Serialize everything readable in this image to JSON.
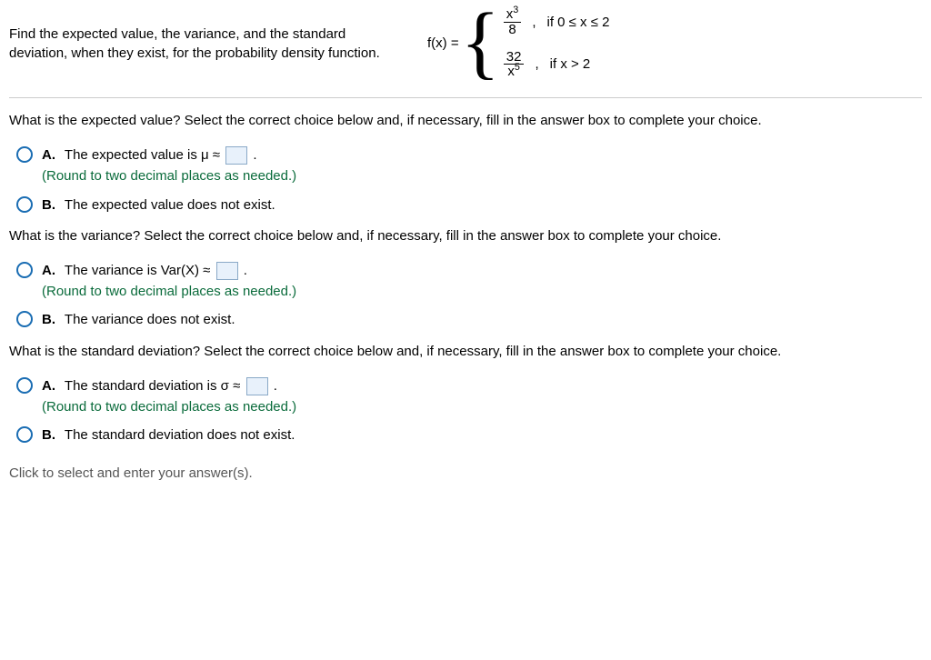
{
  "prompt": "Find the expected value, the variance, and the standard deviation, when they exist, for the probability density function.",
  "formula": {
    "lhs": "f(x) =",
    "case1": {
      "num": "x",
      "num_sup": "3",
      "den": "8",
      "cond": "if 0 ≤ x ≤ 2"
    },
    "case2": {
      "num": "32",
      "den_base": "x",
      "den_sup": "5",
      "cond": "if x > 2"
    }
  },
  "q1": {
    "question": "What is the expected value? Select the correct choice below and, if necessary, fill in the answer box to complete your choice.",
    "A_pre": "The expected value is μ ≈",
    "A_post": ".",
    "hint": "(Round to two decimal places as needed.)",
    "B": "The expected value does not exist."
  },
  "q2": {
    "question": "What is the variance? Select the correct choice below and, if necessary, fill in the answer box to complete your choice.",
    "A_pre": "The variance is Var(X) ≈",
    "A_post": ".",
    "hint": "(Round to two decimal places as needed.)",
    "B": "The variance does not exist."
  },
  "q3": {
    "question": "What is the standard deviation? Select the correct choice below and, if necessary, fill in the answer box to complete your choice.",
    "A_pre": "The standard deviation is σ ≈",
    "A_post": ".",
    "hint": "(Round to two decimal places as needed.)",
    "B": "The standard deviation does not exist."
  },
  "labels": {
    "A": "A.",
    "B": "B."
  },
  "footer": "Click to select and enter your answer(s)."
}
